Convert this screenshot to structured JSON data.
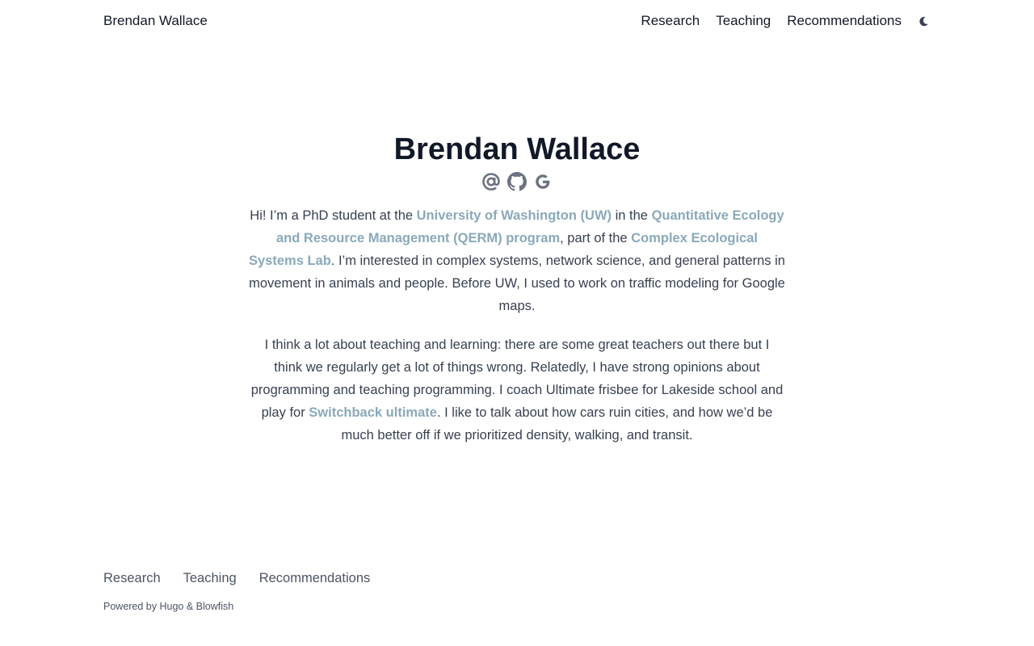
{
  "header": {
    "site_title": "Brendan Wallace",
    "nav": [
      "Research",
      "Teaching",
      "Recommendations"
    ],
    "theme_toggle_icon": "moon-icon"
  },
  "hero": {
    "title": "Brendan Wallace",
    "social_icons": [
      "at-sign-icon",
      "github-icon",
      "google-icon"
    ]
  },
  "bio": {
    "p1": {
      "t1": "Hi! I’m a PhD student at the ",
      "l1": "University of Washington (UW)",
      "t2": " in the ",
      "l2": "Quantitative Ecology and Resource Management (QERM) program",
      "t3": ", part of the ",
      "l3": "Complex Ecological Systems Lab",
      "t4": ". I’m interested in complex systems, network science, and general patterns in movement in animals and people. Before UW, I used to work on traffic modeling for Google maps."
    },
    "p2": {
      "t1": "I think a lot about teaching and learning: there are some great teachers out there but I think we regularly get a lot of things wrong. Relatedly, I have strong opinions about programming and teaching programming. I coach Ultimate frisbee for Lakeside school and play for ",
      "l1": "Switchback ultimate",
      "t2": ". I like to talk about how cars ruin cities, and how we’d be much better off if we prioritized density, walking, and transit."
    }
  },
  "footer": {
    "nav": [
      "Research",
      "Teaching",
      "Recommendations"
    ],
    "powered_prefix": "Powered by ",
    "hugo": "Hugo",
    "amp": " & ",
    "blowfish": "Blowfish"
  },
  "colors": {
    "link": "#8aa9b9",
    "text": "#374151",
    "heading": "#111827",
    "icon": "#6b7280"
  }
}
